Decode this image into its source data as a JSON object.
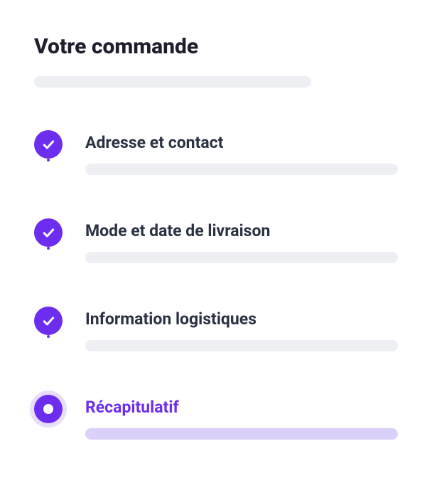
{
  "header": {
    "title": "Votre commande"
  },
  "colors": {
    "accent": "#6d2dee",
    "placeholder": "#edeff3",
    "placeholder_active": "#dad0f9",
    "text": "#2a3142",
    "title": "#1e1e2d",
    "halo": "#e8ddfa"
  },
  "steps": [
    {
      "label": "Adresse et contact",
      "state": "completed"
    },
    {
      "label": "Mode et date de livraison",
      "state": "completed"
    },
    {
      "label": "Information logistiques",
      "state": "completed"
    },
    {
      "label": "Récapitulatif",
      "state": "current"
    }
  ]
}
